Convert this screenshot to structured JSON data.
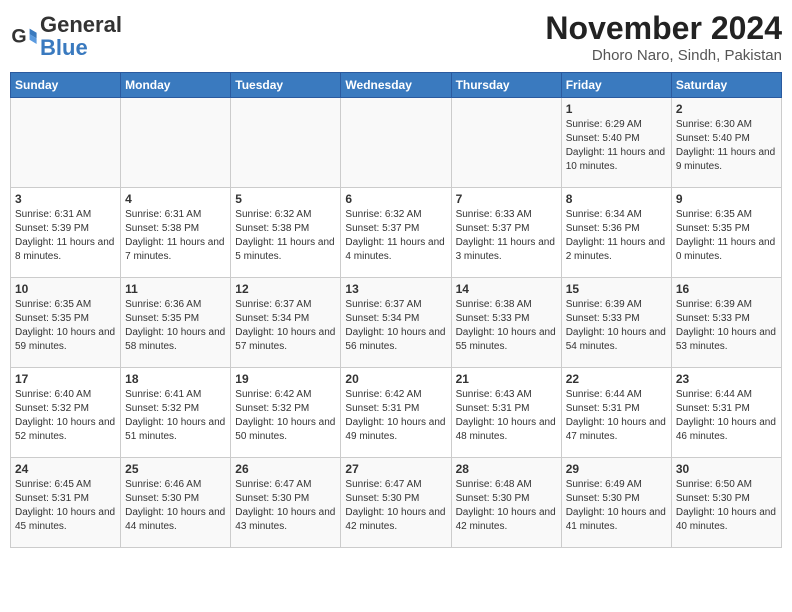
{
  "header": {
    "logo_text_general": "General",
    "logo_text_blue": "Blue",
    "month_title": "November 2024",
    "location": "Dhoro Naro, Sindh, Pakistan"
  },
  "days_of_week": [
    "Sunday",
    "Monday",
    "Tuesday",
    "Wednesday",
    "Thursday",
    "Friday",
    "Saturday"
  ],
  "weeks": [
    {
      "days": [
        {
          "num": "",
          "empty": true
        },
        {
          "num": "",
          "empty": true
        },
        {
          "num": "",
          "empty": true
        },
        {
          "num": "",
          "empty": true
        },
        {
          "num": "",
          "empty": true
        },
        {
          "num": "1",
          "sunrise": "6:29 AM",
          "sunset": "5:40 PM",
          "daylight": "11 hours and 10 minutes."
        },
        {
          "num": "2",
          "sunrise": "6:30 AM",
          "sunset": "5:40 PM",
          "daylight": "11 hours and 9 minutes."
        }
      ]
    },
    {
      "days": [
        {
          "num": "3",
          "sunrise": "6:31 AM",
          "sunset": "5:39 PM",
          "daylight": "11 hours and 8 minutes."
        },
        {
          "num": "4",
          "sunrise": "6:31 AM",
          "sunset": "5:38 PM",
          "daylight": "11 hours and 7 minutes."
        },
        {
          "num": "5",
          "sunrise": "6:32 AM",
          "sunset": "5:38 PM",
          "daylight": "11 hours and 5 minutes."
        },
        {
          "num": "6",
          "sunrise": "6:32 AM",
          "sunset": "5:37 PM",
          "daylight": "11 hours and 4 minutes."
        },
        {
          "num": "7",
          "sunrise": "6:33 AM",
          "sunset": "5:37 PM",
          "daylight": "11 hours and 3 minutes."
        },
        {
          "num": "8",
          "sunrise": "6:34 AM",
          "sunset": "5:36 PM",
          "daylight": "11 hours and 2 minutes."
        },
        {
          "num": "9",
          "sunrise": "6:35 AM",
          "sunset": "5:35 PM",
          "daylight": "11 hours and 0 minutes."
        }
      ]
    },
    {
      "days": [
        {
          "num": "10",
          "sunrise": "6:35 AM",
          "sunset": "5:35 PM",
          "daylight": "10 hours and 59 minutes."
        },
        {
          "num": "11",
          "sunrise": "6:36 AM",
          "sunset": "5:35 PM",
          "daylight": "10 hours and 58 minutes."
        },
        {
          "num": "12",
          "sunrise": "6:37 AM",
          "sunset": "5:34 PM",
          "daylight": "10 hours and 57 minutes."
        },
        {
          "num": "13",
          "sunrise": "6:37 AM",
          "sunset": "5:34 PM",
          "daylight": "10 hours and 56 minutes."
        },
        {
          "num": "14",
          "sunrise": "6:38 AM",
          "sunset": "5:33 PM",
          "daylight": "10 hours and 55 minutes."
        },
        {
          "num": "15",
          "sunrise": "6:39 AM",
          "sunset": "5:33 PM",
          "daylight": "10 hours and 54 minutes."
        },
        {
          "num": "16",
          "sunrise": "6:39 AM",
          "sunset": "5:33 PM",
          "daylight": "10 hours and 53 minutes."
        }
      ]
    },
    {
      "days": [
        {
          "num": "17",
          "sunrise": "6:40 AM",
          "sunset": "5:32 PM",
          "daylight": "10 hours and 52 minutes."
        },
        {
          "num": "18",
          "sunrise": "6:41 AM",
          "sunset": "5:32 PM",
          "daylight": "10 hours and 51 minutes."
        },
        {
          "num": "19",
          "sunrise": "6:42 AM",
          "sunset": "5:32 PM",
          "daylight": "10 hours and 50 minutes."
        },
        {
          "num": "20",
          "sunrise": "6:42 AM",
          "sunset": "5:31 PM",
          "daylight": "10 hours and 49 minutes."
        },
        {
          "num": "21",
          "sunrise": "6:43 AM",
          "sunset": "5:31 PM",
          "daylight": "10 hours and 48 minutes."
        },
        {
          "num": "22",
          "sunrise": "6:44 AM",
          "sunset": "5:31 PM",
          "daylight": "10 hours and 47 minutes."
        },
        {
          "num": "23",
          "sunrise": "6:44 AM",
          "sunset": "5:31 PM",
          "daylight": "10 hours and 46 minutes."
        }
      ]
    },
    {
      "days": [
        {
          "num": "24",
          "sunrise": "6:45 AM",
          "sunset": "5:31 PM",
          "daylight": "10 hours and 45 minutes."
        },
        {
          "num": "25",
          "sunrise": "6:46 AM",
          "sunset": "5:30 PM",
          "daylight": "10 hours and 44 minutes."
        },
        {
          "num": "26",
          "sunrise": "6:47 AM",
          "sunset": "5:30 PM",
          "daylight": "10 hours and 43 minutes."
        },
        {
          "num": "27",
          "sunrise": "6:47 AM",
          "sunset": "5:30 PM",
          "daylight": "10 hours and 42 minutes."
        },
        {
          "num": "28",
          "sunrise": "6:48 AM",
          "sunset": "5:30 PM",
          "daylight": "10 hours and 42 minutes."
        },
        {
          "num": "29",
          "sunrise": "6:49 AM",
          "sunset": "5:30 PM",
          "daylight": "10 hours and 41 minutes."
        },
        {
          "num": "30",
          "sunrise": "6:50 AM",
          "sunset": "5:30 PM",
          "daylight": "10 hours and 40 minutes."
        }
      ]
    }
  ],
  "labels": {
    "sunrise": "Sunrise:",
    "sunset": "Sunset:",
    "daylight": "Daylight:"
  }
}
